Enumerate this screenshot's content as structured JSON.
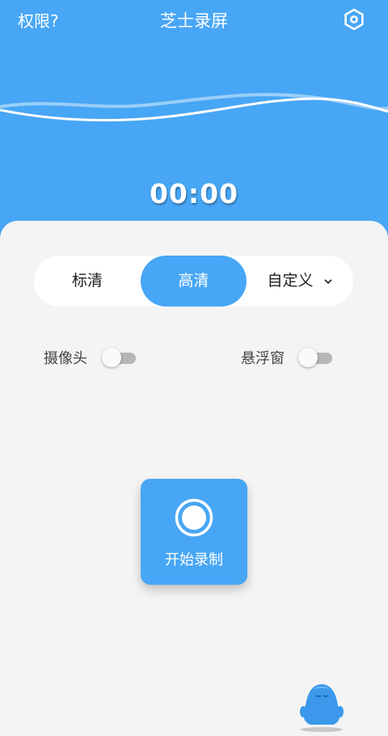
{
  "header": {
    "permission_label": "权限?",
    "app_title": "芝士录屏",
    "timer": "00:00"
  },
  "quality": {
    "options": [
      "标清",
      "高清",
      "自定义"
    ],
    "selected": "高清"
  },
  "toggles": {
    "camera": {
      "label": "摄像头",
      "on": false
    },
    "floating_window": {
      "label": "悬浮窗",
      "on": false
    }
  },
  "record": {
    "label": "开始录制"
  },
  "colors": {
    "primary": "#47a6f5",
    "background": "#f4f4f4"
  },
  "icons": [
    "settings-hexagon-icon",
    "record-circle-icon",
    "mascot-character-icon",
    "chevron-down-icon"
  ]
}
